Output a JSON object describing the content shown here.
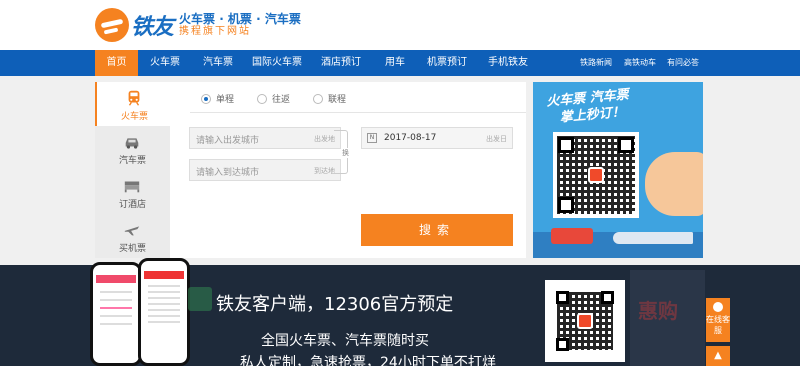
{
  "header": {
    "brand": "铁友",
    "tagline": "火车票 · 机票 · 汽车票",
    "subline": "携程旗下网站"
  },
  "nav": {
    "items": [
      "首页",
      "火车票",
      "汽车票",
      "国际火车票",
      "酒店预订",
      "用车",
      "机票预订",
      "手机铁友"
    ],
    "right": [
      "铁路新闻",
      "高铁动车",
      "有问必答"
    ]
  },
  "sidebar": {
    "items": [
      {
        "label": "火车票",
        "icon": "train-icon"
      },
      {
        "label": "汽车票",
        "icon": "car-icon"
      },
      {
        "label": "订酒店",
        "icon": "bed-icon"
      },
      {
        "label": "买机票",
        "icon": "plane-icon"
      }
    ]
  },
  "search": {
    "trip_types": [
      "单程",
      "往返",
      "联程"
    ],
    "from_placeholder": "请输入出发城市",
    "from_tag": "出发地",
    "to_placeholder": "请输入到达城市",
    "to_tag": "到达地",
    "swap_label": "换",
    "date_icon": "N",
    "date_value": "2017-08-17",
    "date_tag": "出发日",
    "button": "搜索"
  },
  "promo": {
    "title_line1": "火车票 汽车票",
    "title_line2": "掌上秒订！"
  },
  "banner": {
    "title": "铁友客户端，12306官方预定",
    "line2": "全国火车票、汽车票随时买",
    "line3": "私人定制，急速抢票，24小时下单不打烊",
    "deco": "惠购"
  },
  "float": {
    "online_service": "在线客服",
    "top": "▲"
  },
  "colors": {
    "brand_blue": "#0e5fb8",
    "accent_orange": "#f58220"
  }
}
